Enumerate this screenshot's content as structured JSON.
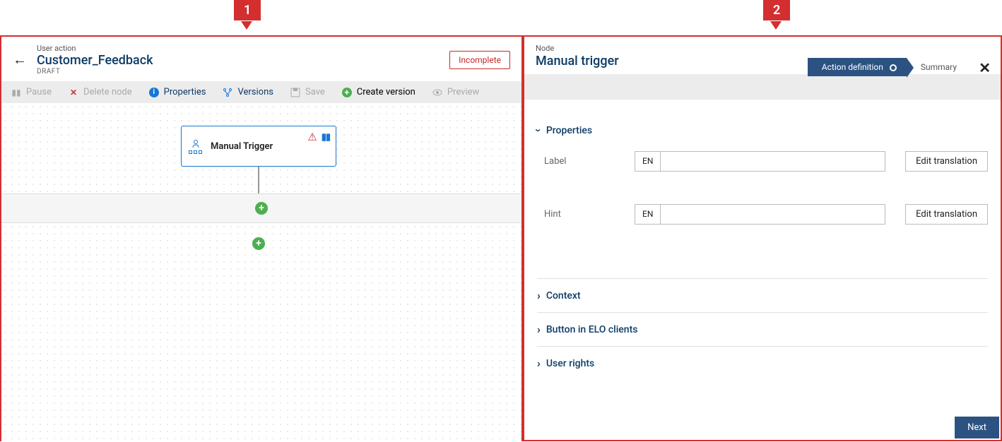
{
  "annotations": {
    "one": "1",
    "two": "2"
  },
  "left": {
    "breadcrumb": "User action",
    "title": "Customer_Feedback",
    "status_draft": "DRAFT",
    "status_badge": "Incomplete",
    "toolbar": {
      "pause": "Pause",
      "delete": "Delete node",
      "properties": "Properties",
      "versions": "Versions",
      "save": "Save",
      "create_version": "Create version",
      "preview": "Preview"
    },
    "node": {
      "label": "Manual Trigger"
    }
  },
  "right": {
    "crumb": "Node",
    "title": "Manual trigger",
    "steps": {
      "active": "Action definition",
      "next": "Summary"
    },
    "sections": {
      "properties": "Properties",
      "context": "Context",
      "button_clients": "Button in ELO clients",
      "user_rights": "User rights"
    },
    "form": {
      "label_label": "Label",
      "hint_label": "Hint",
      "lang": "EN",
      "edit": "Edit translation"
    },
    "next_btn": "Next"
  }
}
